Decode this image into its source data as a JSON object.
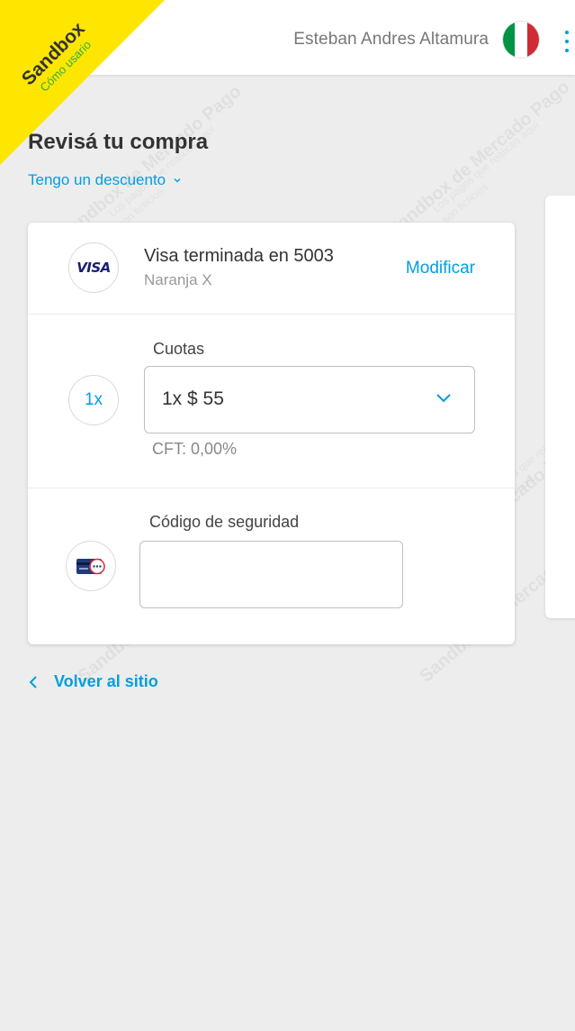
{
  "header": {
    "user_name": "Esteban Andres Altamura",
    "flag_colors": [
      "#009246",
      "#ffffff",
      "#ce2b37"
    ]
  },
  "ribbon": {
    "title": "Sandbox",
    "subtitle": "Cómo usario"
  },
  "watermark": {
    "main": "Sandbox de Mercado Pago",
    "line1": "Los pagos que realices aquí",
    "line2": "son ficticios."
  },
  "page": {
    "title": "Revisá tu compra",
    "discount_link": "Tengo un descuento"
  },
  "payment": {
    "card_brand": "VISA",
    "card_title": "Visa terminada en 5003",
    "card_issuer": "Naranja X",
    "modify_label": "Modificar"
  },
  "installments": {
    "badge": "1x",
    "label": "Cuotas",
    "selected": "1x $ 55",
    "cft": "CFT: 0,00%"
  },
  "security": {
    "label": "Código de seguridad",
    "value": ""
  },
  "footer": {
    "back_label": "Volver al sitio"
  },
  "colors": {
    "accent": "#009ee3",
    "ribbon": "#ffe600",
    "background": "#ededed"
  }
}
